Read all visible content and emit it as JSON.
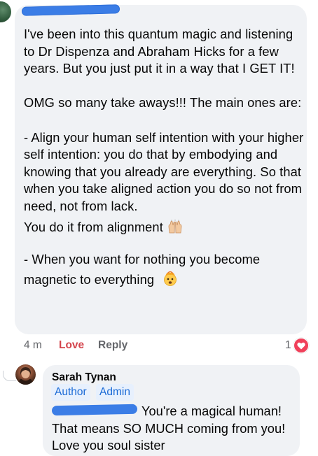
{
  "comment": {
    "paragraphs": [
      "I've been into this quantum magic and listening to Dr Dispenza and Abraham Hicks for a few years. But you just put it in a way that I GET IT!",
      "OMG so many take aways!!! The main ones are:",
      "- Align your human self intention with your higher self intention: you do that by embodying and knowing that you already are everything. So that when you take aligned action you do so not from need, not from lack.",
      "You do it from alignment",
      "- When you want for nothing you become",
      "magnetic to everything"
    ],
    "emoji_1": "raising-hands-emoji",
    "emoji_2": "exploding-head-emoji",
    "time": "4 m",
    "love_label": "Love",
    "reply_label": "Reply",
    "reaction_count": "1",
    "reaction_icon": "heart-icon"
  },
  "reply": {
    "name": "Sarah Tynan",
    "badges": [
      "Author",
      "Admin"
    ],
    "text_1": "You're a magical human!",
    "text_2": "That means SO MUCH coming from you!",
    "text_3": "Love you soul sister"
  },
  "colors": {
    "bubble": "#f0f2f5",
    "love": "#d4454d",
    "badge_text": "#1a6ad6",
    "badge_bg": "#e7f0fd",
    "redaction": "#3b7de6"
  }
}
